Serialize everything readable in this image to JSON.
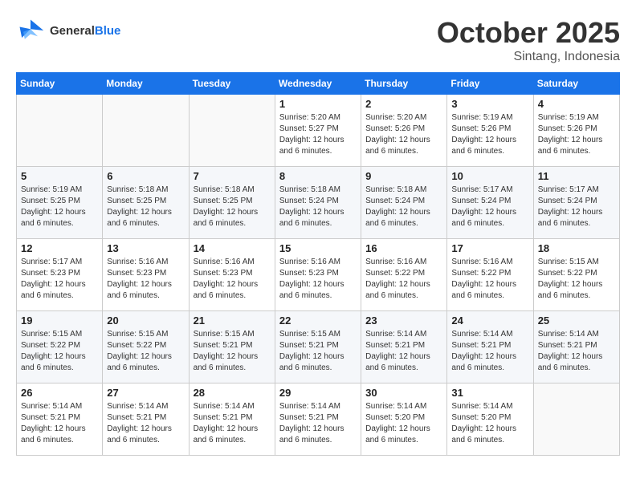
{
  "logo": {
    "line1": "General",
    "line2": "Blue"
  },
  "title": "October 2025",
  "location": "Sintang, Indonesia",
  "days_of_week": [
    "Sunday",
    "Monday",
    "Tuesday",
    "Wednesday",
    "Thursday",
    "Friday",
    "Saturday"
  ],
  "weeks": [
    [
      {
        "day": "",
        "info": ""
      },
      {
        "day": "",
        "info": ""
      },
      {
        "day": "",
        "info": ""
      },
      {
        "day": "1",
        "info": "Sunrise: 5:20 AM\nSunset: 5:27 PM\nDaylight: 12 hours and 6 minutes."
      },
      {
        "day": "2",
        "info": "Sunrise: 5:20 AM\nSunset: 5:26 PM\nDaylight: 12 hours and 6 minutes."
      },
      {
        "day": "3",
        "info": "Sunrise: 5:19 AM\nSunset: 5:26 PM\nDaylight: 12 hours and 6 minutes."
      },
      {
        "day": "4",
        "info": "Sunrise: 5:19 AM\nSunset: 5:26 PM\nDaylight: 12 hours and 6 minutes."
      }
    ],
    [
      {
        "day": "5",
        "info": "Sunrise: 5:19 AM\nSunset: 5:25 PM\nDaylight: 12 hours and 6 minutes."
      },
      {
        "day": "6",
        "info": "Sunrise: 5:18 AM\nSunset: 5:25 PM\nDaylight: 12 hours and 6 minutes."
      },
      {
        "day": "7",
        "info": "Sunrise: 5:18 AM\nSunset: 5:25 PM\nDaylight: 12 hours and 6 minutes."
      },
      {
        "day": "8",
        "info": "Sunrise: 5:18 AM\nSunset: 5:24 PM\nDaylight: 12 hours and 6 minutes."
      },
      {
        "day": "9",
        "info": "Sunrise: 5:18 AM\nSunset: 5:24 PM\nDaylight: 12 hours and 6 minutes."
      },
      {
        "day": "10",
        "info": "Sunrise: 5:17 AM\nSunset: 5:24 PM\nDaylight: 12 hours and 6 minutes."
      },
      {
        "day": "11",
        "info": "Sunrise: 5:17 AM\nSunset: 5:24 PM\nDaylight: 12 hours and 6 minutes."
      }
    ],
    [
      {
        "day": "12",
        "info": "Sunrise: 5:17 AM\nSunset: 5:23 PM\nDaylight: 12 hours and 6 minutes."
      },
      {
        "day": "13",
        "info": "Sunrise: 5:16 AM\nSunset: 5:23 PM\nDaylight: 12 hours and 6 minutes."
      },
      {
        "day": "14",
        "info": "Sunrise: 5:16 AM\nSunset: 5:23 PM\nDaylight: 12 hours and 6 minutes."
      },
      {
        "day": "15",
        "info": "Sunrise: 5:16 AM\nSunset: 5:23 PM\nDaylight: 12 hours and 6 minutes."
      },
      {
        "day": "16",
        "info": "Sunrise: 5:16 AM\nSunset: 5:22 PM\nDaylight: 12 hours and 6 minutes."
      },
      {
        "day": "17",
        "info": "Sunrise: 5:16 AM\nSunset: 5:22 PM\nDaylight: 12 hours and 6 minutes."
      },
      {
        "day": "18",
        "info": "Sunrise: 5:15 AM\nSunset: 5:22 PM\nDaylight: 12 hours and 6 minutes."
      }
    ],
    [
      {
        "day": "19",
        "info": "Sunrise: 5:15 AM\nSunset: 5:22 PM\nDaylight: 12 hours and 6 minutes."
      },
      {
        "day": "20",
        "info": "Sunrise: 5:15 AM\nSunset: 5:22 PM\nDaylight: 12 hours and 6 minutes."
      },
      {
        "day": "21",
        "info": "Sunrise: 5:15 AM\nSunset: 5:21 PM\nDaylight: 12 hours and 6 minutes."
      },
      {
        "day": "22",
        "info": "Sunrise: 5:15 AM\nSunset: 5:21 PM\nDaylight: 12 hours and 6 minutes."
      },
      {
        "day": "23",
        "info": "Sunrise: 5:14 AM\nSunset: 5:21 PM\nDaylight: 12 hours and 6 minutes."
      },
      {
        "day": "24",
        "info": "Sunrise: 5:14 AM\nSunset: 5:21 PM\nDaylight: 12 hours and 6 minutes."
      },
      {
        "day": "25",
        "info": "Sunrise: 5:14 AM\nSunset: 5:21 PM\nDaylight: 12 hours and 6 minutes."
      }
    ],
    [
      {
        "day": "26",
        "info": "Sunrise: 5:14 AM\nSunset: 5:21 PM\nDaylight: 12 hours and 6 minutes."
      },
      {
        "day": "27",
        "info": "Sunrise: 5:14 AM\nSunset: 5:21 PM\nDaylight: 12 hours and 6 minutes."
      },
      {
        "day": "28",
        "info": "Sunrise: 5:14 AM\nSunset: 5:21 PM\nDaylight: 12 hours and 6 minutes."
      },
      {
        "day": "29",
        "info": "Sunrise: 5:14 AM\nSunset: 5:21 PM\nDaylight: 12 hours and 6 minutes."
      },
      {
        "day": "30",
        "info": "Sunrise: 5:14 AM\nSunset: 5:20 PM\nDaylight: 12 hours and 6 minutes."
      },
      {
        "day": "31",
        "info": "Sunrise: 5:14 AM\nSunset: 5:20 PM\nDaylight: 12 hours and 6 minutes."
      },
      {
        "day": "",
        "info": ""
      }
    ]
  ]
}
